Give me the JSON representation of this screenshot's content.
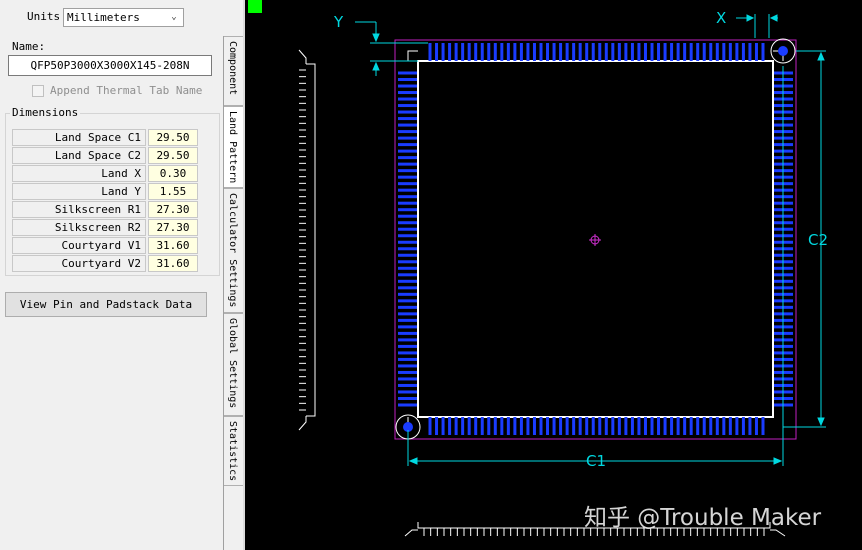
{
  "units": {
    "label": "Units",
    "value": "Millimeters"
  },
  "name": {
    "label": "Name:",
    "value": "QFP50P3000X3000X145-208N"
  },
  "thermal": {
    "label": "Append Thermal Tab Name",
    "checked": false
  },
  "dimensions": {
    "title": "Dimensions",
    "rows": [
      {
        "label": "Land Space C1",
        "value": "29.50"
      },
      {
        "label": "Land Space C2",
        "value": "29.50"
      },
      {
        "label": "Land  X",
        "value": "0.30"
      },
      {
        "label": "Land Y",
        "value": "1.55"
      },
      {
        "label": "Silkscreen R1",
        "value": "27.30"
      },
      {
        "label": "Silkscreen R2",
        "value": "27.30"
      },
      {
        "label": "Courtyard V1",
        "value": "31.60"
      },
      {
        "label": "Courtyard V2",
        "value": "31.60"
      }
    ]
  },
  "view_button": "View Pin and Padstack Data",
  "tabs": [
    "Component",
    "Land Pattern",
    "Calculator Settings",
    "Global Settings",
    "Statistics"
  ],
  "active_tab": "Land Pattern",
  "canvas": {
    "dim_labels": {
      "x": "X",
      "y": "Y",
      "c1": "C1",
      "c2": "C2"
    },
    "colors": {
      "background": "#000000",
      "pad": "#1a3cff",
      "outline": "#ffffff",
      "courtyard": "#c020c0",
      "dimension": "#00d8e0",
      "indicator": "#00ff00"
    }
  },
  "watermark": "知乎 @Trouble Maker"
}
